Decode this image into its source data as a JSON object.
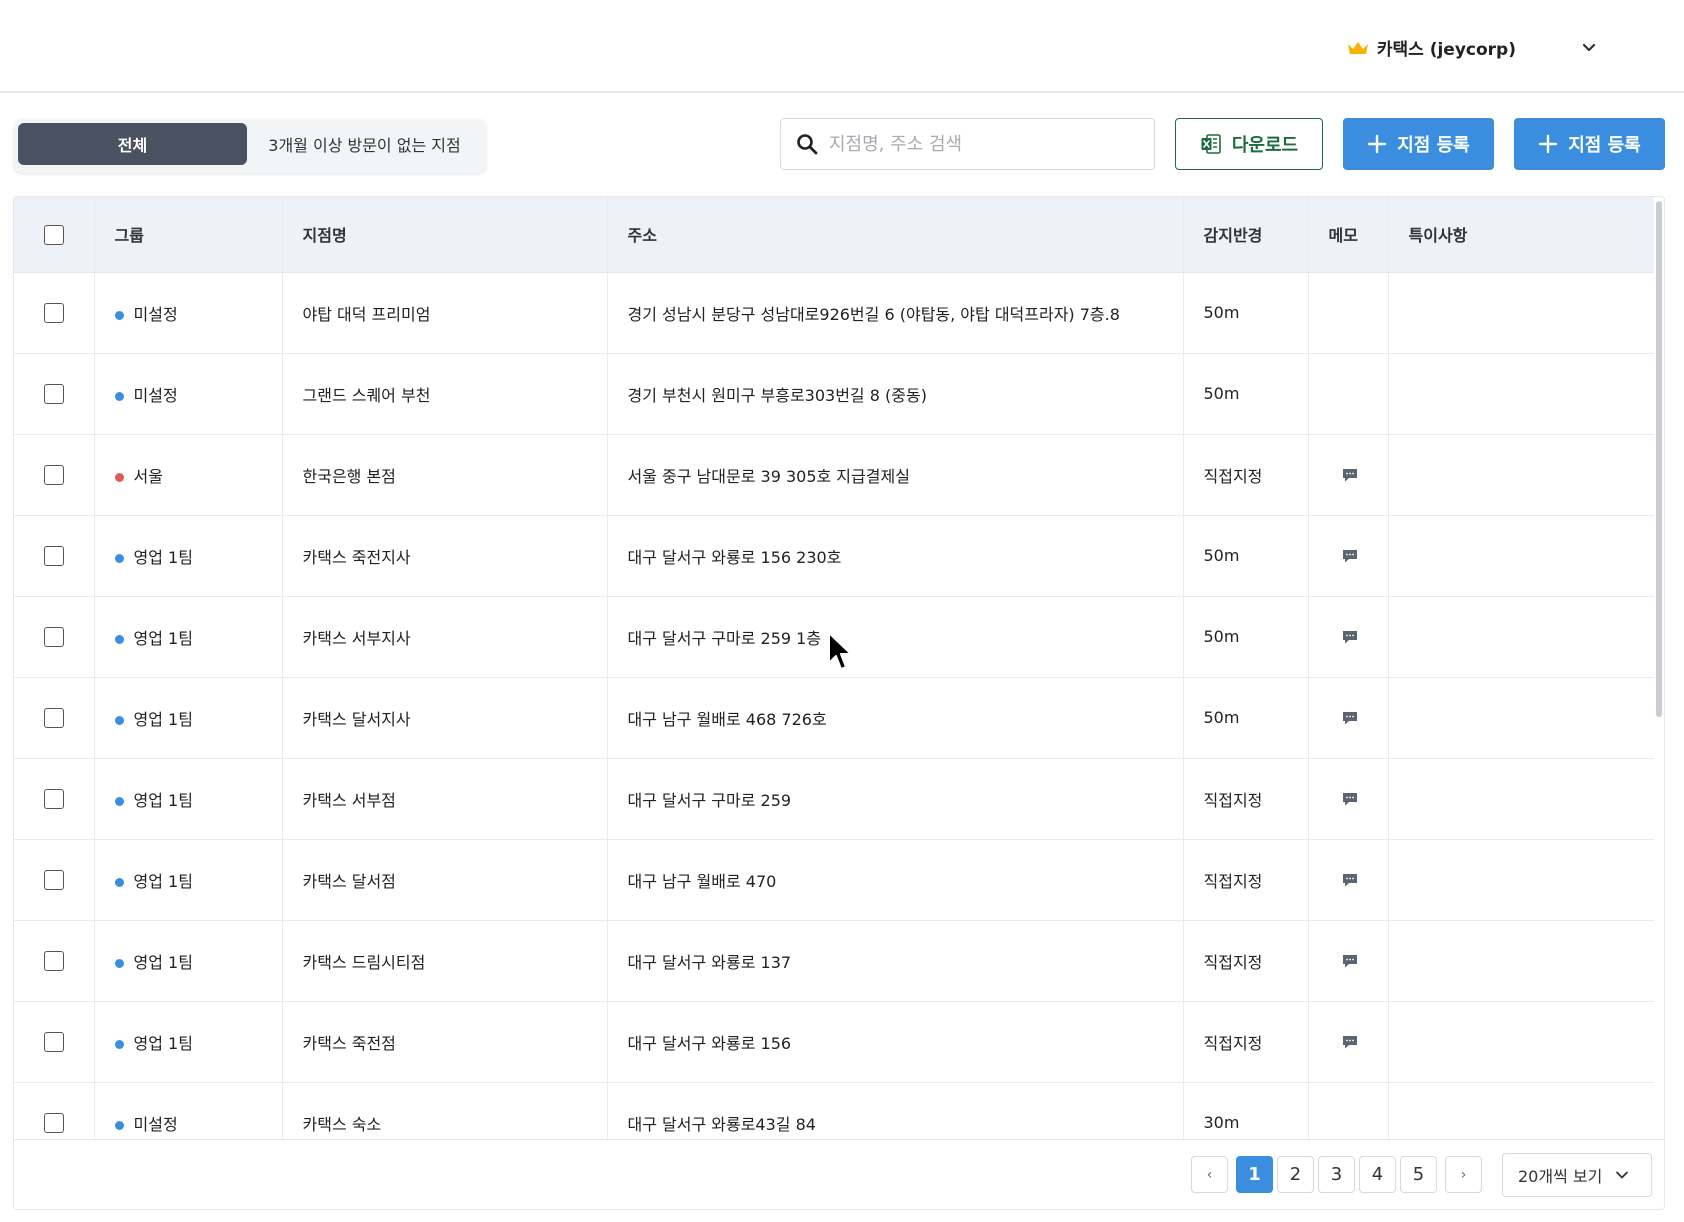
{
  "header": {
    "account_name": "카택스 (jeycorp)",
    "account_icon": "crown-icon",
    "crown_color": "#f4b400"
  },
  "filters": {
    "all_label": "전체",
    "inactive_label": "3개월 이상 방문이 없는 지점"
  },
  "search": {
    "placeholder": "지점명, 주소 검색",
    "value": ""
  },
  "actions": {
    "download_label": "다운로드",
    "add_label_1": "지점 등록",
    "add_label_2": "지점 등록"
  },
  "table": {
    "columns": [
      "그룹",
      "지점명",
      "주소",
      "감지반경",
      "메모",
      "특이사항"
    ],
    "rows": [
      {
        "group": "미설정",
        "group_color": "#3b8de0",
        "name": "야탑 대덕 프리미엄",
        "address": "경기 성남시 분당구 성남대로926번길 6 (야탑동, 야탑 대덕프라자) 7층.8",
        "radius": "50m",
        "memo": false,
        "note": ""
      },
      {
        "group": "미설정",
        "group_color": "#3b8de0",
        "name": "그랜드 스퀘어 부천",
        "address": "경기 부천시 원미구 부흥로303번길 8 (중동)",
        "radius": "50m",
        "memo": false,
        "note": ""
      },
      {
        "group": "서울",
        "group_color": "#e05a5a",
        "name": "한국은행 본점",
        "address": "서울 중구 남대문로 39 305호 지급결제실",
        "radius": "직접지정",
        "memo": true,
        "note": ""
      },
      {
        "group": "영업 1팀",
        "group_color": "#3b8de0",
        "name": "카택스 죽전지사",
        "address": "대구 달서구 와룡로 156 230호",
        "radius": "50m",
        "memo": true,
        "note": ""
      },
      {
        "group": "영업 1팀",
        "group_color": "#3b8de0",
        "name": "카택스 서부지사",
        "address": "대구 달서구 구마로 259 1층",
        "radius": "50m",
        "memo": true,
        "note": ""
      },
      {
        "group": "영업 1팀",
        "group_color": "#3b8de0",
        "name": "카택스 달서지사",
        "address": "대구 남구 월배로 468 726호",
        "radius": "50m",
        "memo": true,
        "note": ""
      },
      {
        "group": "영업 1팀",
        "group_color": "#3b8de0",
        "name": "카택스 서부점",
        "address": "대구 달서구 구마로 259",
        "radius": "직접지정",
        "memo": true,
        "note": ""
      },
      {
        "group": "영업 1팀",
        "group_color": "#3b8de0",
        "name": "카택스 달서점",
        "address": "대구 남구 월배로 470",
        "radius": "직접지정",
        "memo": true,
        "note": ""
      },
      {
        "group": "영업 1팀",
        "group_color": "#3b8de0",
        "name": "카택스 드림시티점",
        "address": "대구 달서구 와룡로 137",
        "radius": "직접지정",
        "memo": true,
        "note": ""
      },
      {
        "group": "영업 1팀",
        "group_color": "#3b8de0",
        "name": "카택스 죽전점",
        "address": "대구 달서구 와룡로 156",
        "radius": "직접지정",
        "memo": true,
        "note": ""
      },
      {
        "group": "미설정",
        "group_color": "#3b8de0",
        "name": "카택스 숙소",
        "address": "대구 달서구 와룡로43길 84",
        "radius": "30m",
        "memo": false,
        "note": ""
      }
    ]
  },
  "pagination": {
    "prev": "‹",
    "next": "›",
    "pages": [
      "1",
      "2",
      "3",
      "4",
      "5"
    ],
    "current": "1",
    "page_size_label": "20개씩 보기"
  },
  "colors": {
    "primary": "#3b8de0",
    "segment_active": "#4a5261",
    "download_green": "#1e6b3f",
    "header_bg": "#edf2f9",
    "memo_icon": "#5b6472"
  }
}
